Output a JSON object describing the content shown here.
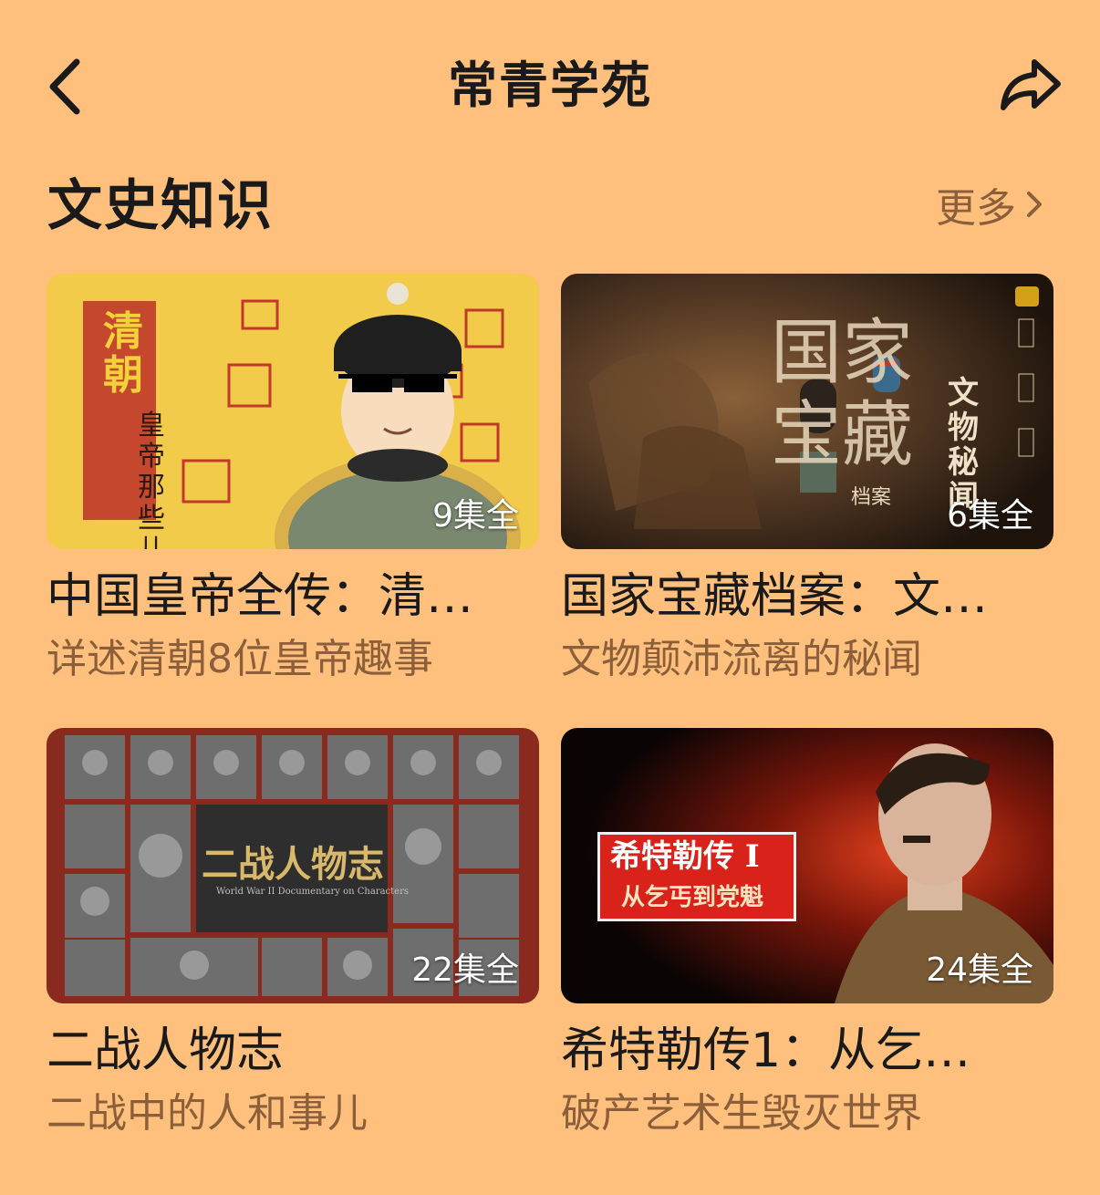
{
  "nav": {
    "back_icon": "chevron-left-icon",
    "title": "常青学苑",
    "share_icon": "share-arrow-icon"
  },
  "section": {
    "title": "文史知识",
    "more_label": "更多",
    "more_icon": "chevron-right-icon"
  },
  "cards": [
    {
      "title": "中国皇帝全传：清…",
      "subtitle": "详述清朝8位皇帝趣事",
      "badge": "9集全",
      "thumb_text": [
        "清朝",
        "皇帝那些儿事"
      ]
    },
    {
      "title": "国家宝藏档案：文…",
      "subtitle": "文物颠沛流离的秘闻",
      "badge": "6集全",
      "thumb_text": [
        "国家宝藏",
        "文物秘闻",
        "档案"
      ]
    },
    {
      "title": "二战人物志",
      "subtitle": "二战中的人和事儿",
      "badge": "22集全",
      "thumb_text": [
        "二战人物志",
        "World War II Documentary on Characters"
      ]
    },
    {
      "title": "希特勒传1：从乞丐…",
      "subtitle": "破产艺术生毁灭世界",
      "badge": "24集全",
      "thumb_text": [
        "希特勒传 I",
        "从乞丐到党魁"
      ]
    }
  ],
  "colors": {
    "background": "#ffbf7d",
    "secondary_text": "#8a5f3a",
    "primary_text": "#1a1a1a"
  }
}
